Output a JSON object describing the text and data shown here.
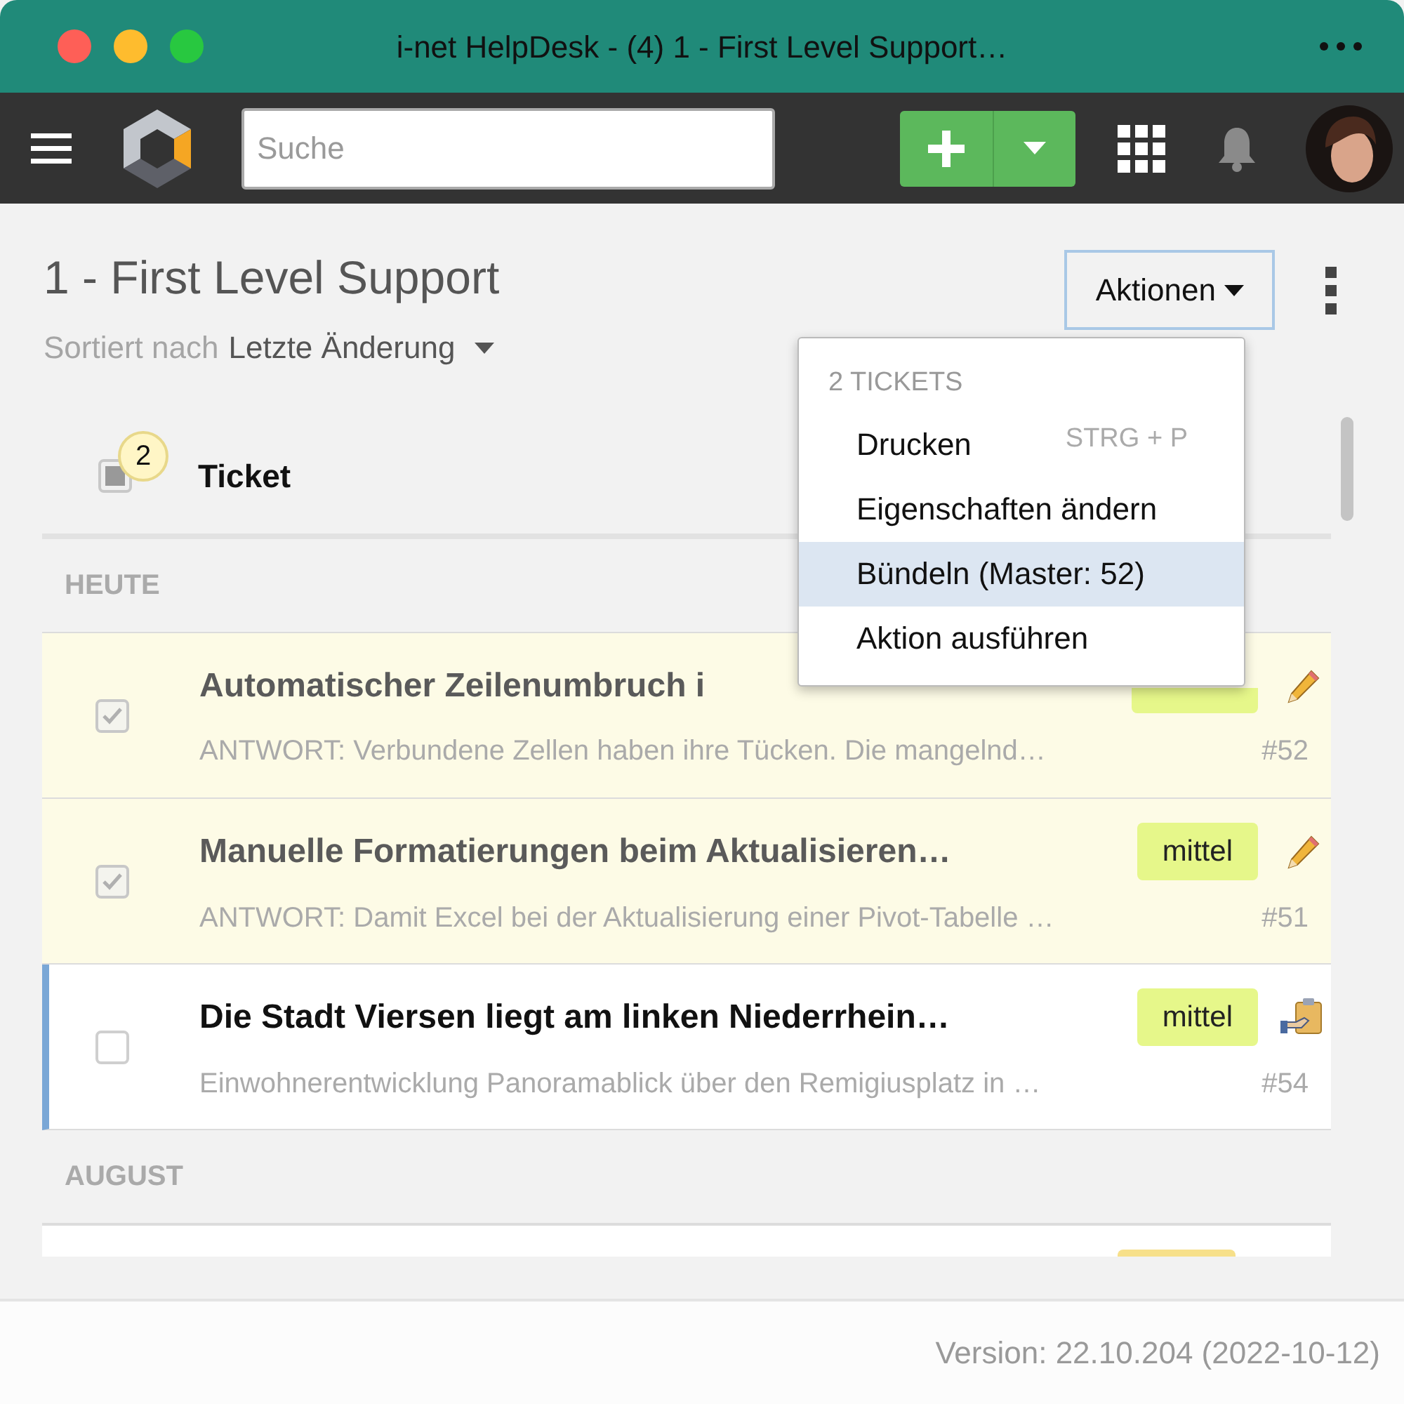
{
  "window": {
    "title": "i-net HelpDesk - (4) 1 - First Level Support…"
  },
  "toolbar": {
    "search": {
      "placeholder": "Suche"
    }
  },
  "header": {
    "title": "1 - First Level Support",
    "sort_label": "Sortiert nach",
    "sort_value": "Letzte Änderung",
    "actions_button": "Aktionen"
  },
  "actions_menu": {
    "heading": "2 TICKETS",
    "items": [
      {
        "label": "Drucken",
        "shortcut": "STRG + P",
        "selected": false
      },
      {
        "label": "Eigenschaften ändern",
        "selected": false
      },
      {
        "label": "Bündeln (Master: 52)",
        "selected": true
      },
      {
        "label": "Aktion ausführen",
        "selected": false
      }
    ]
  },
  "list_header": {
    "selected_count": "2",
    "column": "Ticket",
    "indeterminate": true
  },
  "groups": [
    {
      "label": "HEUTE",
      "rows": [
        {
          "kind": "edit",
          "title": "Automatischer Zeilenumbruch i",
          "preview": "ANTWORT: Verbundene Zellen haben ihre Tücken. Die mangelnd…",
          "color": "#e6f78a",
          "number": "#52",
          "checked": true,
          "active": false
        },
        {
          "kind": "edit",
          "title": "Manuelle Formatierungen beim Aktualisieren…",
          "preview": "ANTWORT: Damit Excel bei der Aktualisierung einer Pivot-Tabelle …",
          "priority": "mittel",
          "color": "#e6f78a",
          "number": "#51",
          "checked": true,
          "active": false
        },
        {
          "kind": "assigned",
          "title": "Die Stadt Viersen liegt am linken Niederrhein…",
          "preview": "Einwohnerentwicklung Panoramablick über den Remigiusplatz in …",
          "priority": "mittel",
          "color": "#e6f78a",
          "number": "#54",
          "checked": false,
          "active": true
        }
      ]
    },
    {
      "label": "AUGUST",
      "rows": [
        {
          "kind": "partial",
          "color": "#f7e08a"
        }
      ]
    }
  ],
  "footer": {
    "version": "Version: 22.10.204 (2022-10-12)"
  }
}
